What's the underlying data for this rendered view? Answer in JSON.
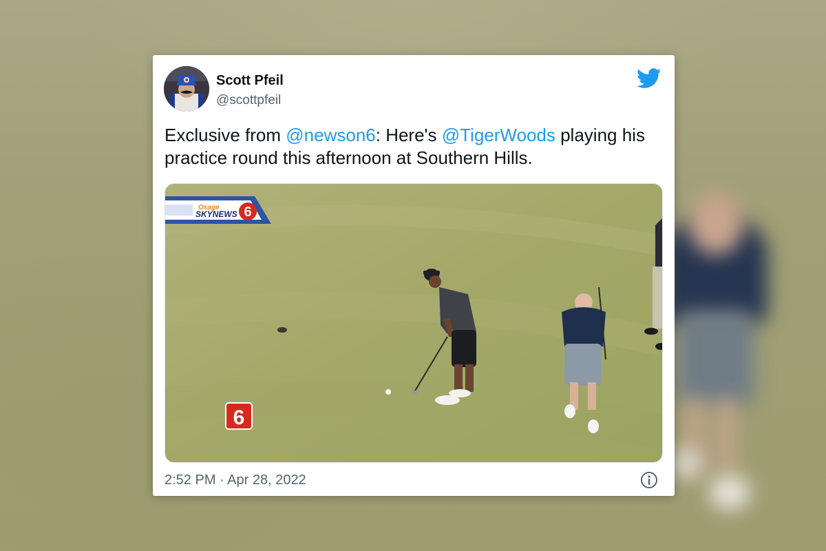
{
  "tweet": {
    "author_name": "Scott Pfeil",
    "author_handle": "@scottpfeil",
    "text_prefix": "Exclusive from ",
    "mention_1": "@newson6",
    "text_middle": ": Here's ",
    "mention_2": "@TigerWoods",
    "text_suffix": " playing his practice round this afternoon at Southern Hills.",
    "timestamp": "2:52 PM · Apr 28, 2022"
  },
  "media": {
    "overlay_brand_small": "Osage",
    "overlay_brand": "SKYNEWS",
    "overlay_channel": "6",
    "watermark_channel": "6"
  },
  "icons": {
    "platform": "twitter-bird-icon",
    "info": "info-icon"
  },
  "colors": {
    "link": "#1d9bf0",
    "twitter_blue": "#1d9bf0",
    "secondary_text": "#536471",
    "news_red": "#d62a1f",
    "grass": "#a8ab6c"
  }
}
